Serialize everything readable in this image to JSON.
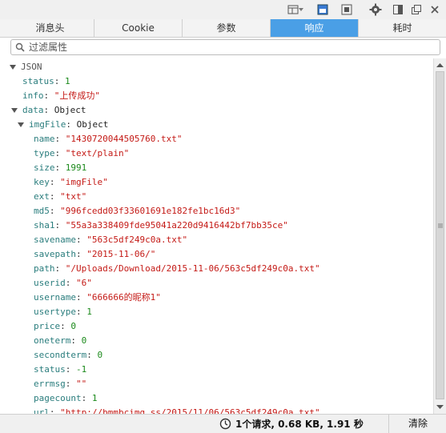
{
  "tabs": [
    {
      "label": "消息头"
    },
    {
      "label": "Cookie"
    },
    {
      "label": "参数"
    },
    {
      "label": "响应"
    },
    {
      "label": "耗时"
    }
  ],
  "filter": {
    "placeholder": "过滤属性"
  },
  "tree": {
    "root_label": "JSON",
    "status": {
      "key": "status",
      "value": "1"
    },
    "info": {
      "key": "info",
      "value": "\"上传成功\""
    },
    "data": {
      "key": "data",
      "value": "Object"
    },
    "imgFile": {
      "key": "imgFile",
      "value": "Object"
    },
    "fields": [
      {
        "key": "name",
        "value": "\"1430720044505760.txt\"",
        "kind": "str"
      },
      {
        "key": "type",
        "value": "\"text/plain\"",
        "kind": "str"
      },
      {
        "key": "size",
        "value": "1991",
        "kind": "num"
      },
      {
        "key": "key",
        "value": "\"imgFile\"",
        "kind": "str"
      },
      {
        "key": "ext",
        "value": "\"txt\"",
        "kind": "str"
      },
      {
        "key": "md5",
        "value": "\"996fcedd03f33601691e182fe1bc16d3\"",
        "kind": "str"
      },
      {
        "key": "sha1",
        "value": "\"55a3a338409fde95041a220d9416442bf7bb35ce\"",
        "kind": "str"
      },
      {
        "key": "savename",
        "value": "\"563c5df249c0a.txt\"",
        "kind": "str"
      },
      {
        "key": "savepath",
        "value": "\"2015-11-06/\"",
        "kind": "str"
      },
      {
        "key": "path",
        "value": "\"/Uploads/Download/2015-11-06/563c5df249c0a.txt\"",
        "kind": "str"
      },
      {
        "key": "userid",
        "value": "\"6\"",
        "kind": "str"
      },
      {
        "key": "username",
        "value": "\"666666的昵称1\"",
        "kind": "str"
      },
      {
        "key": "usertype",
        "value": "1",
        "kind": "num"
      },
      {
        "key": "price",
        "value": "0",
        "kind": "num"
      },
      {
        "key": "oneterm",
        "value": "0",
        "kind": "num"
      },
      {
        "key": "secondterm",
        "value": "0",
        "kind": "num"
      },
      {
        "key": "status",
        "value": "-1",
        "kind": "num"
      },
      {
        "key": "errmsg",
        "value": "\"\"",
        "kind": "str"
      },
      {
        "key": "pagecount",
        "value": "1",
        "kind": "num"
      },
      {
        "key": "url",
        "value": "\"http://bmmbcimg.ss/2015/11/06/563c5df249c0a.txt\"",
        "kind": "str"
      }
    ]
  },
  "status_bar": {
    "summary": "1个请求, 0.68 KB, 1.91 秒",
    "clear_label": "清除"
  },
  "colors": {
    "accent": "#4a9fe6",
    "key": "#2a7d7d",
    "string": "#c41a16",
    "number": "#1c8a1c"
  },
  "icons": [
    "layout-icon",
    "dropdown-icon",
    "console-icon",
    "inspector-icon",
    "gear-icon",
    "dock-side-icon",
    "undock-icon",
    "close-icon",
    "search-icon",
    "timer-icon"
  ]
}
